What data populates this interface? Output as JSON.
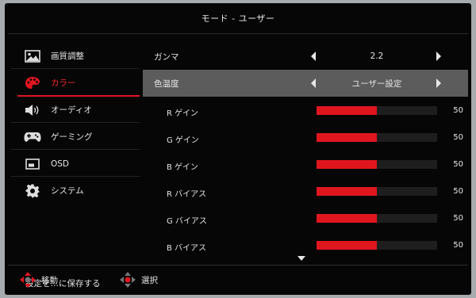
{
  "window": {
    "title": "モード - ユーザー"
  },
  "sidebar": {
    "items": [
      {
        "label": "画質調整",
        "icon": "picture-icon",
        "active": false
      },
      {
        "label": "カラー",
        "icon": "palette-icon",
        "active": true
      },
      {
        "label": "オーディオ",
        "icon": "speaker-icon",
        "active": false
      },
      {
        "label": "ゲーミング",
        "icon": "gamepad-icon",
        "active": false
      },
      {
        "label": "OSD",
        "icon": "osd-window-icon",
        "active": false
      },
      {
        "label": "システム",
        "icon": "gear-icon",
        "active": false
      }
    ],
    "save_label": "設定を…に保存する"
  },
  "main": {
    "gamma": {
      "label": "ガンマ",
      "value": "2.2"
    },
    "color_temp": {
      "label": "色温度",
      "value": "ユーザー設定"
    },
    "sliders": [
      {
        "label": "R  ゲイン",
        "value": "50",
        "level": 0.5
      },
      {
        "label": "G  ゲイン",
        "value": "50",
        "level": 0.5
      },
      {
        "label": "B  ゲイン",
        "value": "50",
        "level": 0.5
      },
      {
        "label": "R  バイアス",
        "value": "50",
        "level": 0.5
      },
      {
        "label": "G  バイアス",
        "value": "50",
        "level": 0.5
      },
      {
        "label": "B  バイアス",
        "value": "50",
        "level": 0.5
      }
    ]
  },
  "footer": {
    "move_label": "移動",
    "select_label": "選択"
  },
  "colors": {
    "accent": "#e0161f",
    "selected_row": "#5c5c5c",
    "background": "#060606"
  }
}
